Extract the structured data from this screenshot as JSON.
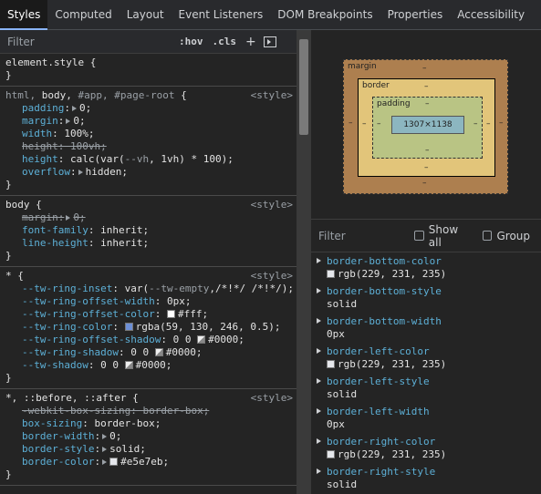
{
  "tabs": [
    "Styles",
    "Computed",
    "Layout",
    "Event Listeners",
    "DOM Breakpoints",
    "Properties",
    "Accessibility"
  ],
  "filter": {
    "placeholder": "Filter",
    "hov": ":hov",
    "cls": ".cls",
    "plus": "+"
  },
  "rules": {
    "r0": {
      "selector": "element.style {",
      "close": "}"
    },
    "r1": {
      "sel_a": "html,",
      "sel_b": "body,",
      "sel_c": "#app,",
      "sel_d": "#page-root",
      "brace": "{",
      "src": "<style>",
      "d0n": "padding",
      "d0v": "0;",
      "d1n": "margin",
      "d1v": "0;",
      "d2n": "width",
      "d2v": "100%;",
      "d3n": "height",
      "d3v": "100vh;",
      "d4n": "height",
      "d4v": "calc(var(",
      "d4var": "--vh",
      "d4rest": ", 1vh) * 100);",
      "d5n": "overflow",
      "d5v": "hidden;",
      "close": "}"
    },
    "r2": {
      "sel": "body {",
      "src": "<style>",
      "d0n": "margin",
      "d0v": "0;",
      "d1n": "font-family",
      "d1v": "inherit;",
      "d2n": "line-height",
      "d2v": "inherit;",
      "close": "}"
    },
    "r3": {
      "sel": "* {",
      "src": "<style>",
      "d0n": "--tw-ring-inset",
      "d0a": "var(",
      "d0var": "--tw-empty",
      ",d0b": ",/*!*/ /*!*/);",
      "d1n": "--tw-ring-offset-width",
      "d1v": "0px;",
      "d2n": "--tw-ring-offset-color",
      "d2v": "#fff;",
      "d3n": "--tw-ring-color",
      "d3v": "rgba(59, 130, 246, 0.5);",
      "d4n": "--tw-ring-offset-shadow",
      "d4v": "0 0",
      "d4c": "#0000;",
      "d5n": "--tw-ring-shadow",
      "d5v": "0 0",
      "d5c": "#0000;",
      "d6n": "--tw-shadow",
      "d6v": "0 0",
      "d6c": "#0000;",
      "close": "}"
    },
    "r4": {
      "sel": "*, ::before, ::after {",
      "src": "<style>",
      "d0n": "-webkit-box-sizing",
      "d0v": "border-box;",
      "d1n": "box-sizing",
      "d1v": "border-box;",
      "d2n": "border-width",
      "d2v": "0;",
      "d3n": "border-style",
      "d3v": "solid;",
      "d4n": "border-color",
      "d4v": "#e5e7eb;",
      "close": "}"
    }
  },
  "boxmodel": {
    "margin": "margin",
    "border": "border",
    "padding": "padding",
    "content": "1307×1138",
    "dash": "–"
  },
  "computed": {
    "filter": "Filter",
    "show_all": "Show all",
    "group": "Group",
    "props": [
      {
        "name": "border-bottom-color",
        "value": "rgb(229, 231, 235)",
        "swatch": true
      },
      {
        "name": "border-bottom-style",
        "value": "solid",
        "swatch": false
      },
      {
        "name": "border-bottom-width",
        "value": "0px",
        "swatch": false
      },
      {
        "name": "border-left-color",
        "value": "rgb(229, 231, 235)",
        "swatch": true
      },
      {
        "name": "border-left-style",
        "value": "solid",
        "swatch": false
      },
      {
        "name": "border-left-width",
        "value": "0px",
        "swatch": false
      },
      {
        "name": "border-right-color",
        "value": "rgb(229, 231, 235)",
        "swatch": true
      },
      {
        "name": "border-right-style",
        "value": "solid",
        "swatch": false
      }
    ]
  },
  "colors": {
    "accent": "#8ab4f8",
    "prop_name": "#5db0d7",
    "swatch_white": "#ffffff",
    "swatch_ring": "#3b82f6",
    "swatch_gray": "#e5e7eb",
    "swatch_transparent": "#000000"
  }
}
